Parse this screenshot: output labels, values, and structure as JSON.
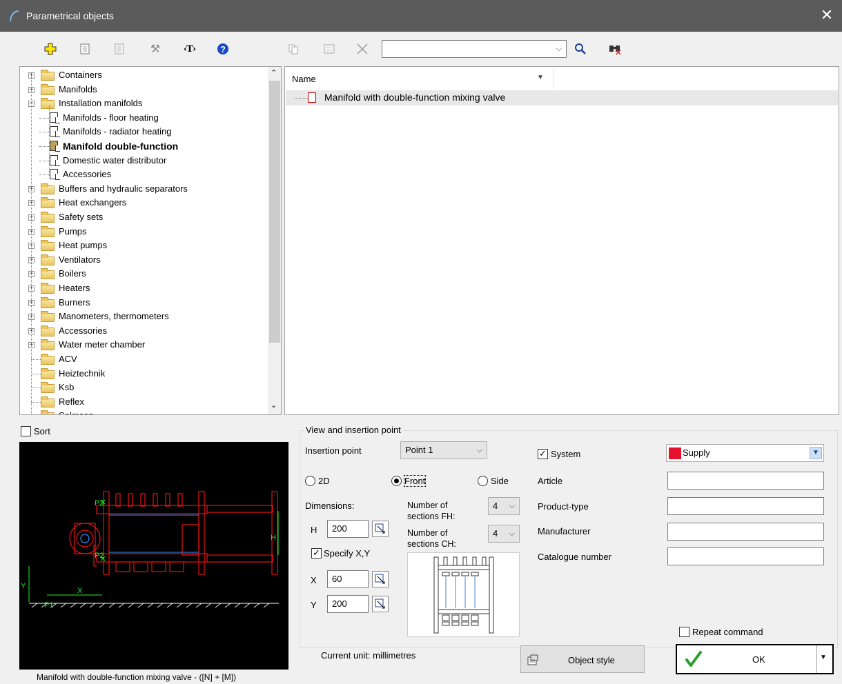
{
  "window": {
    "title": "Parametrical objects",
    "close": "✕"
  },
  "toolbar": {
    "search_value": ""
  },
  "tree": [
    {
      "label": "Containers",
      "type": "folder",
      "level": 0,
      "expander": "+"
    },
    {
      "label": "Manifolds",
      "type": "folder",
      "level": 0,
      "expander": "+"
    },
    {
      "label": "Installation manifolds",
      "type": "folder",
      "level": 0,
      "expander": "−"
    },
    {
      "label": "Manifolds - floor heating",
      "type": "doc",
      "level": 1,
      "expander": ""
    },
    {
      "label": "Manifolds - radiator heating",
      "type": "doc",
      "level": 1,
      "expander": ""
    },
    {
      "label": "Manifold double-function",
      "type": "doc",
      "level": 1,
      "expander": "",
      "selected": true
    },
    {
      "label": "Domestic water distributor",
      "type": "doc",
      "level": 1,
      "expander": ""
    },
    {
      "label": "Accessories",
      "type": "doc",
      "level": 1,
      "expander": ""
    },
    {
      "label": "Buffers and hydraulic separators",
      "type": "folder",
      "level": 0,
      "expander": "+"
    },
    {
      "label": "Heat exchangers",
      "type": "folder",
      "level": 0,
      "expander": "+"
    },
    {
      "label": "Safety sets",
      "type": "folder",
      "level": 0,
      "expander": "+"
    },
    {
      "label": "Pumps",
      "type": "folder",
      "level": 0,
      "expander": "+"
    },
    {
      "label": "Heat pumps",
      "type": "folder",
      "level": 0,
      "expander": "+"
    },
    {
      "label": "Ventilators",
      "type": "folder",
      "level": 0,
      "expander": "+"
    },
    {
      "label": "Boilers",
      "type": "folder",
      "level": 0,
      "expander": "+"
    },
    {
      "label": "Heaters",
      "type": "folder",
      "level": 0,
      "expander": "+"
    },
    {
      "label": "Burners",
      "type": "folder",
      "level": 0,
      "expander": "+"
    },
    {
      "label": "Manometers, thermometers",
      "type": "folder",
      "level": 0,
      "expander": "+"
    },
    {
      "label": "Accessories",
      "type": "folder",
      "level": 0,
      "expander": "+"
    },
    {
      "label": "Water meter chamber",
      "type": "folder",
      "level": 0,
      "expander": "+"
    },
    {
      "label": "ACV",
      "type": "folder",
      "level": 0,
      "expander": ""
    },
    {
      "label": "Heiztechnik",
      "type": "folder",
      "level": 0,
      "expander": ""
    },
    {
      "label": "Ksb",
      "type": "folder",
      "level": 0,
      "expander": ""
    },
    {
      "label": "Reflex",
      "type": "folder",
      "level": 0,
      "expander": ""
    },
    {
      "label": "Salmson",
      "type": "folder",
      "level": 0,
      "expander": ""
    }
  ],
  "list": {
    "column_name": "Name",
    "items": [
      "Manifold with double-function mixing valve"
    ]
  },
  "sort_label": "Sort",
  "preview": {
    "caption": "Manifold with double-function mixing valve - ([N] + [M])",
    "labels": {
      "p1": "P1",
      "p2": "P2",
      "p3": "P3",
      "x": "X",
      "y": "Y",
      "h": "H"
    }
  },
  "view": {
    "group_label": "View and insertion point",
    "insertion_label": "Insertion point",
    "insertion_value": "Point 1",
    "radio_2d": "2D",
    "radio_front": "Front",
    "radio_side": "Side",
    "selected_view": "Front",
    "dimensions_label": "Dimensions:",
    "h_label": "H",
    "h_value": "200",
    "specify_label": "Specify X,Y",
    "specify_checked": true,
    "x_label": "X",
    "x_value": "60",
    "y_label": "Y",
    "y_value": "200",
    "sections_fh_label1": "Number of",
    "sections_fh_label2": "sections FH:",
    "sections_fh_value": "4",
    "sections_ch_label1": "Number of",
    "sections_ch_label2": "sections CH:",
    "sections_ch_value": "4"
  },
  "props": {
    "system_label": "System",
    "system_checked": true,
    "system_value": "Supply",
    "system_color": "#e8112d",
    "article_label": "Article",
    "article_value": "",
    "product_type_label": "Product-type",
    "product_type_value": "",
    "manufacturer_label": "Manufacturer",
    "manufacturer_value": "",
    "catalogue_label": "Catalogue number",
    "catalogue_value": ""
  },
  "repeat_label": "Repeat command",
  "repeat_checked": false,
  "current_unit": "Current unit: millimetres",
  "object_style_label": "Object style",
  "ok_label": "OK"
}
